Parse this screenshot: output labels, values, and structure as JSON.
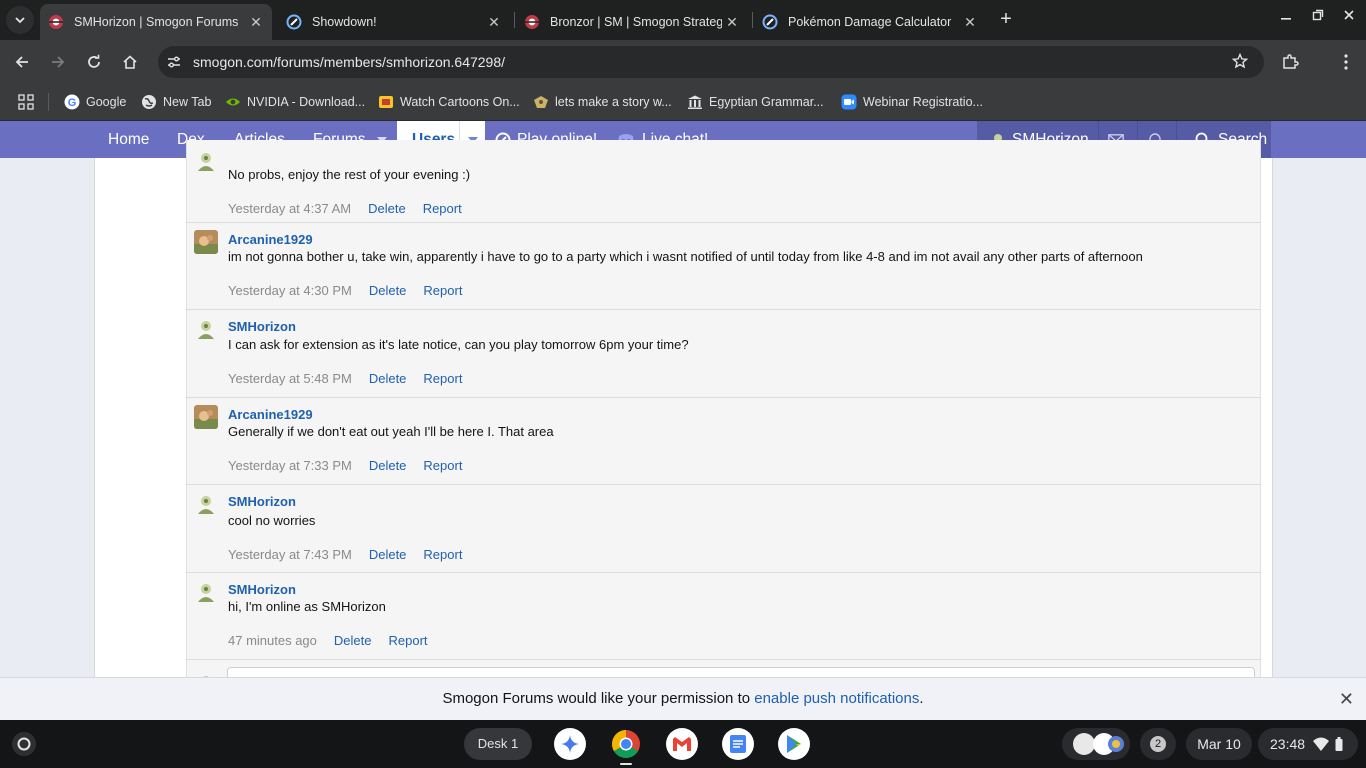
{
  "browser": {
    "tabs": [
      {
        "title": "SMHorizon | Smogon Forums",
        "active": true
      },
      {
        "title": "Showdown!",
        "active": false
      },
      {
        "title": "Bronzor | SM | Smogon Strateg",
        "active": false
      },
      {
        "title": "Pokémon Damage Calculator",
        "active": false
      }
    ],
    "new_tab": "+",
    "close_glyph": "✕",
    "url": "smogon.com/forums/members/smhorizon.647298/",
    "bookmarks": [
      {
        "label": "Google",
        "icon": "google-icon"
      },
      {
        "label": "New Tab",
        "icon": "globe-icon"
      },
      {
        "label": "NVIDIA - Download...",
        "icon": "nvidia-icon"
      },
      {
        "label": "Watch Cartoons On...",
        "icon": "cartoon-icon"
      },
      {
        "label": "lets make a story w...",
        "icon": "story-icon"
      },
      {
        "label": "Egyptian Grammar...",
        "icon": "museum-icon"
      },
      {
        "label": "Webinar Registratio...",
        "icon": "zoom-icon"
      }
    ]
  },
  "site_nav": {
    "home": "Home",
    "dex": "Dex",
    "articles": "Articles",
    "forums": "Forums",
    "users": "Users",
    "play_online": "Play online!",
    "live_chat": "Live chat!",
    "username": "SMHorizon",
    "search": "Search"
  },
  "messages": [
    {
      "author": "",
      "text": "No probs, enjoy the rest of your evening :)",
      "time": "Yesterday at 4:37 AM",
      "delete": "Delete",
      "report": "Report",
      "avatar": "smhorizon"
    },
    {
      "author": "Arcanine1929",
      "text": "im not gonna bother u, take win, apparently i have to go to a party which i wasnt notified of until today from like 4-8 and im not avail any other parts of afternoon",
      "time": "Yesterday at 4:30 PM",
      "delete": "Delete",
      "report": "Report",
      "avatar": "arcanine"
    },
    {
      "author": "SMHorizon",
      "text": "I can ask for extension as it's late notice, can you play tomorrow 6pm your time?",
      "time": "Yesterday at 5:48 PM",
      "delete": "Delete",
      "report": "Report",
      "avatar": "smhorizon"
    },
    {
      "author": "Arcanine1929",
      "text": "Generally if we don't eat out yeah I'll be here I. That area",
      "time": "Yesterday at 7:33 PM",
      "delete": "Delete",
      "report": "Report",
      "avatar": "arcanine"
    },
    {
      "author": "SMHorizon",
      "text": "cool no worries",
      "time": "Yesterday at 7:43 PM",
      "delete": "Delete",
      "report": "Report",
      "avatar": "smhorizon"
    },
    {
      "author": "SMHorizon",
      "text": "hi, I'm online as SMHorizon",
      "time": "47 minutes ago",
      "delete": "Delete",
      "report": "Report",
      "avatar": "smhorizon"
    }
  ],
  "notification": {
    "prefix": "Smogon Forums would like your permission to ",
    "link": "enable push notifications",
    "suffix": ".",
    "close": "✕"
  },
  "shelf": {
    "desk": "Desk 1",
    "notification_count": "2",
    "date": "Mar 10",
    "time": "23:48"
  },
  "colors": {
    "site_nav": "#6a6fc1",
    "link": "#2060b0",
    "chrome_bg": "#1f2020"
  }
}
